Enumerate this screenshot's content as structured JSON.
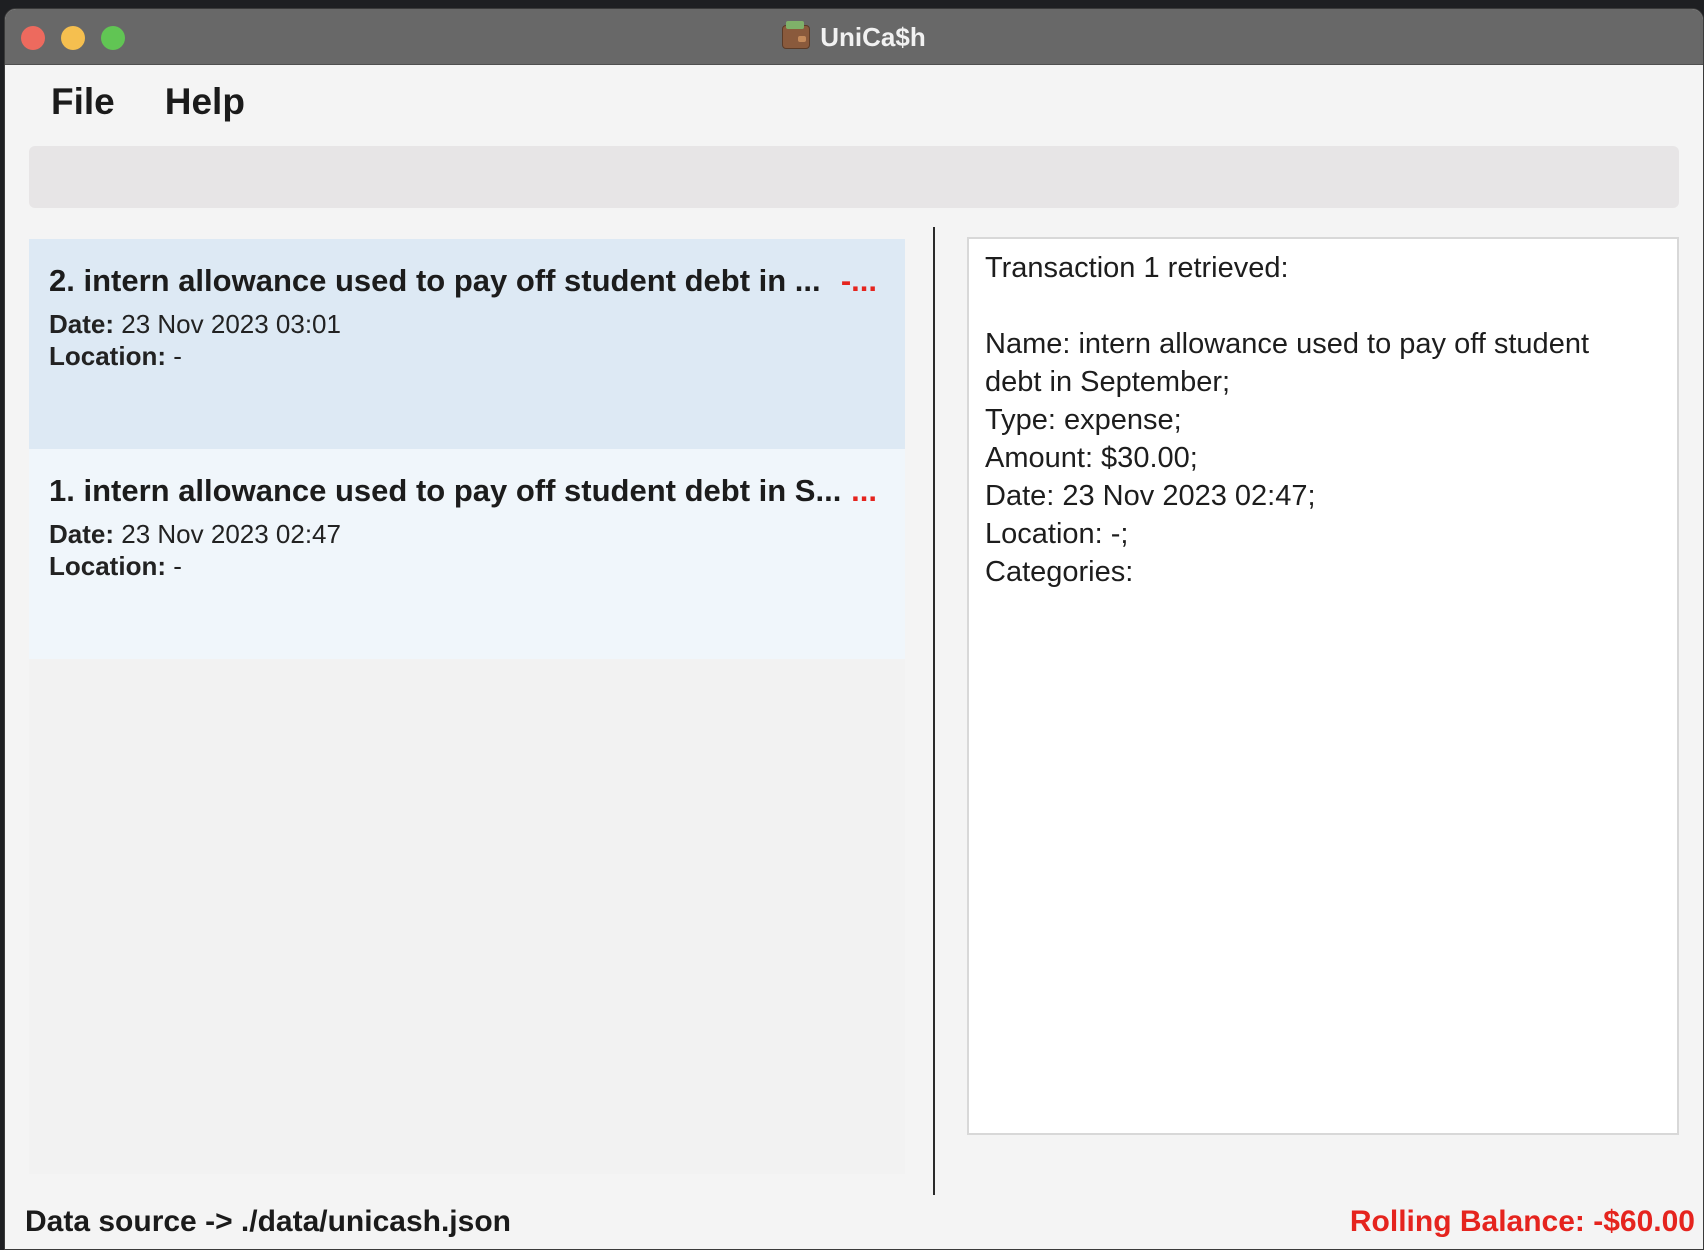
{
  "window": {
    "title": "UniCa$h"
  },
  "menu": {
    "file": "File",
    "help": "Help"
  },
  "command": {
    "value": ""
  },
  "transactions": [
    {
      "title": "2. intern allowance used to pay off student debt in ...",
      "amount": "-...",
      "date_label": "Date:",
      "date": "23 Nov 2023 03:01",
      "location_label": "Location:",
      "location": "-"
    },
    {
      "title": "1. intern allowance used to pay off student debt in S...",
      "amount": "...",
      "date_label": "Date:",
      "date": "23 Nov 2023 02:47",
      "location_label": "Location:",
      "location": "-"
    }
  ],
  "detail": {
    "header": "Transaction 1 retrieved:",
    "name_line1": "Name: intern allowance used to pay off student",
    "name_line2": "debt in September;",
    "type": "Type: expense;",
    "amount": "Amount: $30.00;",
    "date": "Date: 23 Nov 2023 02:47;",
    "location": "Location: -;",
    "categories": "Categories:"
  },
  "status": {
    "data_source": "Data source -> ./data/unicash.json",
    "rolling_balance": "Rolling Balance: -$60.00"
  },
  "colors": {
    "selected_card": "#dde9f4",
    "card": "#f0f6fb",
    "negative": "#e5241e"
  }
}
